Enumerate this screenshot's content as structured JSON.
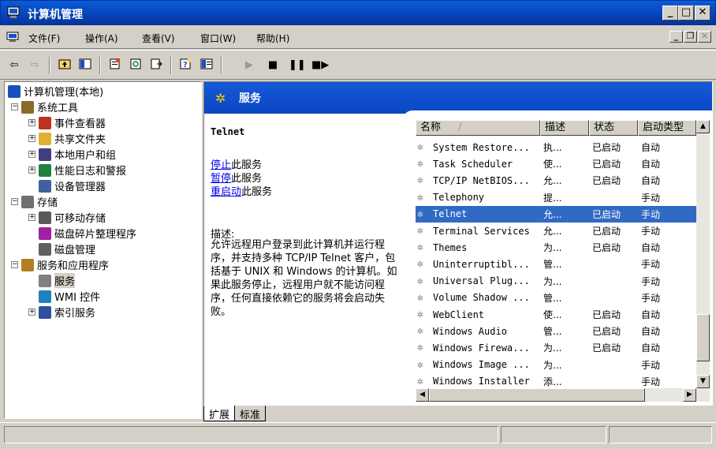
{
  "window": {
    "title": "计算机管理"
  },
  "menu": {
    "items": [
      "文件(F)",
      "操作(A)",
      "查看(V)",
      "窗口(W)",
      "帮助(H)"
    ]
  },
  "tree": {
    "items": [
      {
        "label": "计算机管理(本地)",
        "level": 0,
        "expander": "",
        "icon": "computer-icon"
      },
      {
        "label": "系统工具",
        "level": 1,
        "expander": "−",
        "icon": "tools-icon"
      },
      {
        "label": "事件查看器",
        "level": 2,
        "expander": "+",
        "icon": "event-viewer-icon"
      },
      {
        "label": "共享文件夹",
        "level": 2,
        "expander": "+",
        "icon": "shared-folder-icon"
      },
      {
        "label": "本地用户和组",
        "level": 2,
        "expander": "+",
        "icon": "users-icon"
      },
      {
        "label": "性能日志和警报",
        "level": 2,
        "expander": "+",
        "icon": "performance-icon"
      },
      {
        "label": "设备管理器",
        "level": 2,
        "expander": "",
        "icon": "device-manager-icon"
      },
      {
        "label": "存储",
        "level": 1,
        "expander": "−",
        "icon": "storage-icon"
      },
      {
        "label": "可移动存储",
        "level": 2,
        "expander": "+",
        "icon": "removable-storage-icon"
      },
      {
        "label": "磁盘碎片整理程序",
        "level": 2,
        "expander": "",
        "icon": "defrag-icon"
      },
      {
        "label": "磁盘管理",
        "level": 2,
        "expander": "",
        "icon": "disk-management-icon"
      },
      {
        "label": "服务和应用程序",
        "level": 1,
        "expander": "−",
        "icon": "services-apps-icon"
      },
      {
        "label": "服务",
        "level": 2,
        "expander": "",
        "icon": "services-icon",
        "selected": true
      },
      {
        "label": "WMI 控件",
        "level": 2,
        "expander": "",
        "icon": "wmi-icon"
      },
      {
        "label": "索引服务",
        "level": 2,
        "expander": "+",
        "icon": "indexing-icon"
      }
    ]
  },
  "banner": {
    "title": "服务"
  },
  "details": {
    "service_name": "Telnet",
    "actions": [
      {
        "link": "停止",
        "rest": "此服务"
      },
      {
        "link": "暂停",
        "rest": "此服务"
      },
      {
        "link": "重启动",
        "rest": "此服务"
      }
    ],
    "desc_label": "描述:",
    "desc_text": "允许远程用户登录到此计算机并运行程序，并支持多种 TCP/IP Telnet 客户，包括基于 UNIX 和 Windows 的计算机。如果此服务停止，远程用户就不能访问程序，任何直接依赖它的服务将会启动失败。"
  },
  "services": {
    "columns": [
      "名称",
      "描述",
      "状态",
      "启动类型"
    ],
    "sort_indicator": "/",
    "rows": [
      {
        "name": "System Restore...",
        "desc": "执...",
        "status": "已启动",
        "start": "自动"
      },
      {
        "name": "Task Scheduler",
        "desc": "使...",
        "status": "已启动",
        "start": "自动"
      },
      {
        "name": "TCP/IP NetBIOS...",
        "desc": "允...",
        "status": "已启动",
        "start": "自动"
      },
      {
        "name": "Telephony",
        "desc": "提...",
        "status": "",
        "start": "手动"
      },
      {
        "name": "Telnet",
        "desc": "允...",
        "status": "已启动",
        "start": "手动",
        "selected": true
      },
      {
        "name": "Terminal Services",
        "desc": "允...",
        "status": "已启动",
        "start": "手动"
      },
      {
        "name": "Themes",
        "desc": "为...",
        "status": "已启动",
        "start": "自动"
      },
      {
        "name": "Uninterruptibl...",
        "desc": "管...",
        "status": "",
        "start": "手动"
      },
      {
        "name": "Universal Plug...",
        "desc": "为...",
        "status": "",
        "start": "手动"
      },
      {
        "name": "Volume Shadow ...",
        "desc": "管...",
        "status": "",
        "start": "手动"
      },
      {
        "name": "WebClient",
        "desc": "使...",
        "status": "已启动",
        "start": "自动"
      },
      {
        "name": "Windows Audio",
        "desc": "管...",
        "status": "已启动",
        "start": "自动"
      },
      {
        "name": "Windows Firewa...",
        "desc": "为...",
        "status": "已启动",
        "start": "自动"
      },
      {
        "name": "Windows Image ...",
        "desc": "为...",
        "status": "",
        "start": "手动"
      },
      {
        "name": "Windows Installer",
        "desc": "添...",
        "status": "",
        "start": "手动"
      }
    ]
  },
  "tabs": [
    "扩展",
    "标准"
  ],
  "colors": {
    "title_blue": "#0842b8",
    "selection": "#316ac5",
    "link": "#0000ee",
    "face": "#d4d0c8"
  }
}
